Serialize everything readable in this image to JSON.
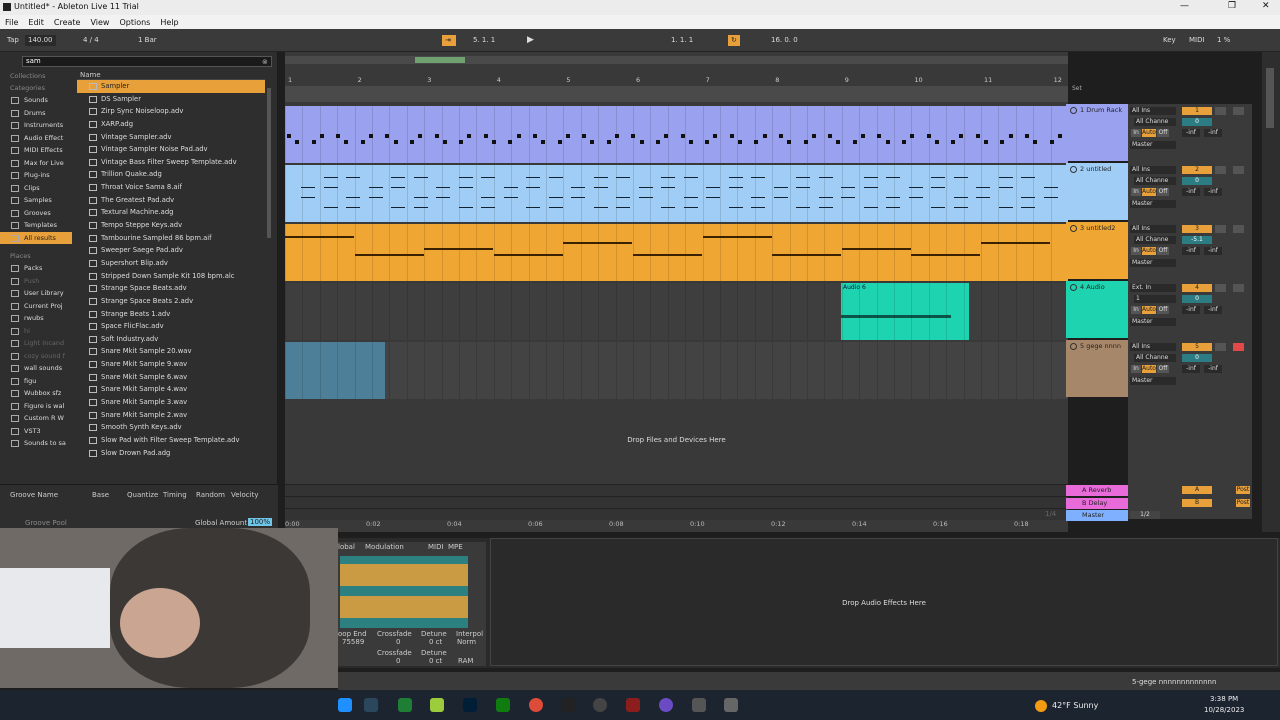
{
  "window": {
    "title": "Untitled* - Ableton Live 11 Trial",
    "controls": [
      "—",
      "❐",
      "✕"
    ]
  },
  "menu": [
    "File",
    "Edit",
    "Create",
    "View",
    "Options",
    "Help"
  ],
  "transport": {
    "tap": "Tap",
    "tempo": "140.00",
    "meter": "4 / 4",
    "quant": "1 Bar",
    "position": "5.  1.  1",
    "loop_start": "1.  1.  1",
    "loop_len": "16.  0.  0",
    "key": "Key",
    "midi": "MIDI",
    "cpu": "1 %"
  },
  "browser": {
    "search": "sam",
    "collections_label": "Collections",
    "categories_label": "Categories",
    "categories": [
      "Sounds",
      "Drums",
      "Instruments",
      "Audio Effect",
      "MIDI Effects",
      "Max for Live",
      "Plug-ins",
      "Clips",
      "Samples",
      "Grooves",
      "Templates",
      "All results"
    ],
    "places_label": "Places",
    "places": [
      "Packs",
      "Push",
      "User Library",
      "Current Proj",
      "rwubs",
      "hi",
      "Light Incand",
      "cozy sound f",
      "wall sounds",
      "figu",
      "Wubbox sfz",
      "Figure is wal",
      "Custom R W",
      "VST3",
      "Sounds to sa"
    ],
    "name_header": "Name",
    "files": [
      "Sampler",
      "DS Sampler",
      "Zirp Sync Noiseloop.adv",
      "XARP.adg",
      "Vintage Sampler.adv",
      "Vintage Sampler Noise Pad.adv",
      "Vintage Bass Filter Sweep Template.adv",
      "Trillion Quake.adg",
      "Throat Voice Sama 8.aif",
      "The Greatest Pad.adv",
      "Textural Machine.adg",
      "Tempo Steppe Keys.adv",
      "Tambourine Sampled 86 bpm.aif",
      "Sweeper Saege Pad.adv",
      "Supershort Blip.adv",
      "Stripped Down Sample Kit 108 bpm.alc",
      "Strange Space Beats.adv",
      "Strange Space Beats 2.adv",
      "Strange Beats 1.adv",
      "Space FlicFlac.adv",
      "Soft Industry.adv",
      "Snare Mkit Sample 20.wav",
      "Snare Mkit Sample 9.wav",
      "Snare Mkit Sample 6.wav",
      "Snare Mkit Sample 4.wav",
      "Snare Mkit Sample 3.wav",
      "Snare Mkit Sample 2.wav",
      "Smooth Synth Keys.adv",
      "Slow Pad with Filter Sweep Template.adv",
      "Slow Drown Pad.adg"
    ]
  },
  "groove": {
    "cols": [
      "Groove Name",
      "Base",
      "Quantize",
      "Timing",
      "Random",
      "Velocity"
    ],
    "pool": "Groove Pool",
    "global_label": "Global Amount",
    "global_value": "100%"
  },
  "ruler": [
    "1",
    "2",
    "3",
    "4",
    "5",
    "6",
    "7",
    "8",
    "9",
    "10",
    "11",
    "12"
  ],
  "set_label": "Set",
  "tracks": [
    {
      "name": "1 Drum Rack",
      "color": "#9aa2f0",
      "input": "All Ins",
      "channel": "All Channe",
      "num": "1"
    },
    {
      "name": "2 untitled",
      "color": "#9fcdf5",
      "input": "All Ins",
      "channel": "All Channe",
      "num": "2"
    },
    {
      "name": "3 untitled2",
      "color": "#f0a632",
      "input": "All Ins",
      "channel": "All Channe",
      "num": "3"
    },
    {
      "name": "4 Audio",
      "color": "#1ed4b0",
      "input": "Ext. In",
      "channel": "1",
      "num": "4"
    },
    {
      "name": "5 gege nnnn",
      "color": "#a6876a",
      "input": "All Ins",
      "channel": "All Channe",
      "num": "5"
    }
  ],
  "track_vol": [
    "0",
    "0",
    "-5.1",
    "0",
    "0"
  ],
  "audio_clip": "Audio 6",
  "monitor": {
    "in": "In",
    "auto": "Auto",
    "off": "Off",
    "inf": "-inf",
    "out": "Master"
  },
  "drop_files": "Drop Files and Devices Here",
  "returns": [
    {
      "name": "A Reverb",
      "send": "A",
      "color": "#e96ad9",
      "mode": "Post"
    },
    {
      "name": "B Delay",
      "send": "B",
      "color": "#e96ad9",
      "mode": "Post"
    },
    {
      "name": "Master",
      "send": "1/2",
      "color": "#7fb0ff",
      "mode": ""
    }
  ],
  "timeline": [
    "0:00",
    "0:02",
    "0:04",
    "0:06",
    "0:08",
    "0:10",
    "0:12",
    "0:14",
    "0:16",
    "0:18"
  ],
  "timeline_frac": "1/4",
  "device": {
    "tabs": [
      "lobal",
      "Modulation",
      "MIDI",
      "MPE"
    ],
    "loop_end_label": "oop End",
    "loop_end_val": "75589",
    "crossfade": "Crossfade",
    "crossfade_val": "0",
    "detune": "Detune",
    "detune_val": "0 ct",
    "interpol": "Interpol",
    "norm": "Norm",
    "ram": "RAM",
    "drop_fx": "Drop Audio Effects Here"
  },
  "status_track": "5-gege nnnnnnnnnnnnn",
  "taskbar": {
    "weather": "42°F  Sunny",
    "time": "3:38 PM",
    "date": "10/28/2023"
  }
}
